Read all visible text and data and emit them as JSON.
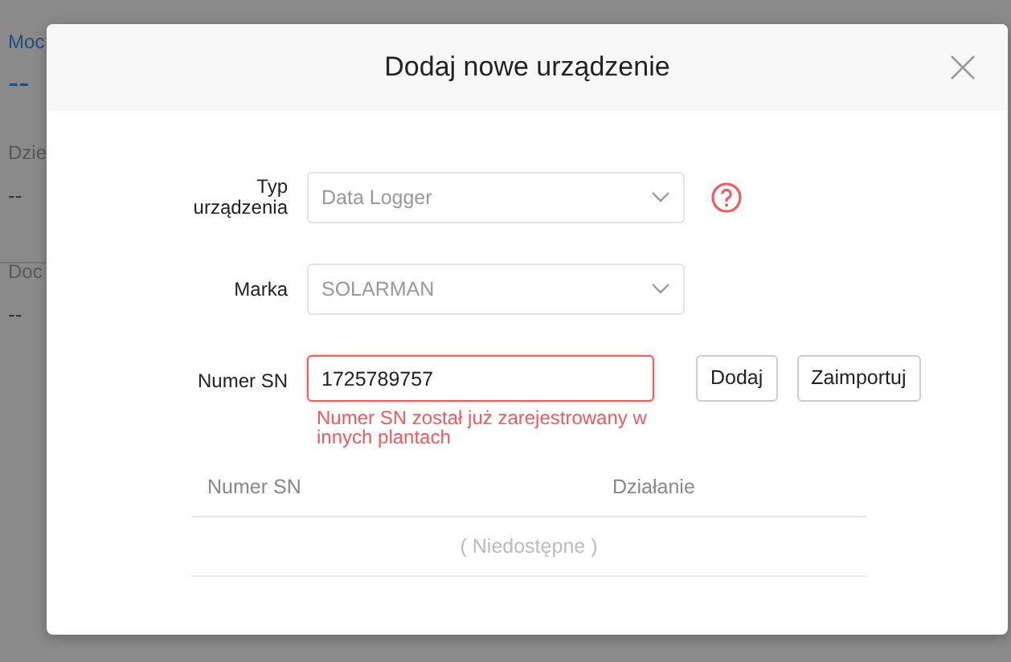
{
  "background": {
    "items": [
      {
        "kind": "title",
        "text": "Moc"
      },
      {
        "kind": "value",
        "text": "--"
      },
      {
        "kind": "label",
        "text": "Dzie"
      },
      {
        "kind": "small",
        "text": "--"
      },
      {
        "kind": "label",
        "text": "Doc"
      },
      {
        "kind": "small",
        "text": "--"
      }
    ]
  },
  "dialog": {
    "title": "Dodaj nowe urządzenie",
    "fields": [
      {
        "kind": "select",
        "label": "Typ urządzenia",
        "value": "Data Logger",
        "help": true
      },
      {
        "kind": "select",
        "label": "Marka",
        "value": "SOLARMAN",
        "help": false
      },
      {
        "kind": "input",
        "label": "Numer SN",
        "value": "1725789757",
        "invalid": true,
        "error": "Numer SN został już zarejestrowany w innych plantach",
        "buttons": [
          "Dodaj",
          "Zaimportuj"
        ]
      }
    ],
    "table": {
      "columns": [
        "Numer SN",
        "Działanie"
      ],
      "empty": "( Niedostępne )"
    }
  }
}
